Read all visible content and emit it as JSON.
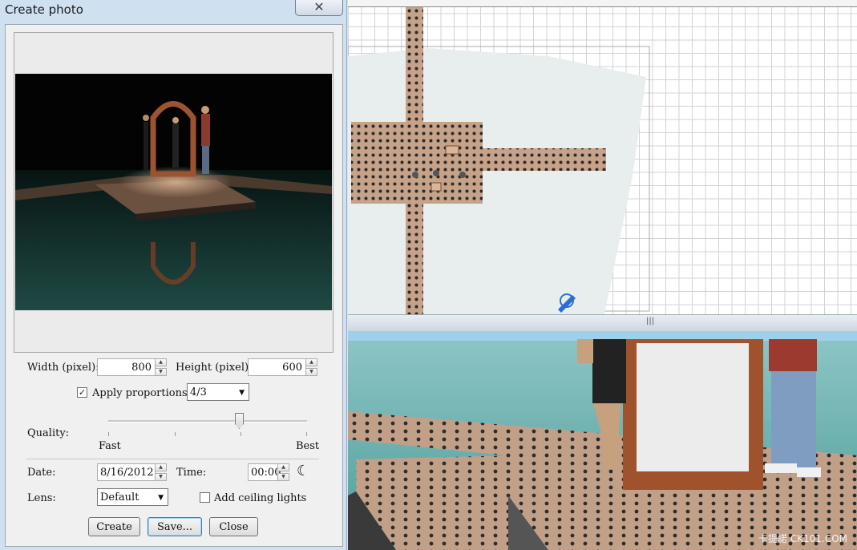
{
  "dialog": {
    "title": "Create photo",
    "close_icon": "close-icon",
    "width_label": "Width (pixel):",
    "width_value": "800",
    "height_label": "Height (pixel):",
    "height_value": "600",
    "apply_proportions_label": "Apply proportions:",
    "apply_proportions_checked": true,
    "proportion_value": "4/3",
    "quality_label": "Quality:",
    "quality_min": "Fast",
    "quality_max": "Best",
    "quality_level": 0.66,
    "date_label": "Date:",
    "date_value": "8/16/2012",
    "time_label": "Time:",
    "time_value": "00:00",
    "time_icon": "moon-icon",
    "lens_label": "Lens:",
    "lens_value": "Default",
    "ceiling_lights_label": "Add ceiling lights",
    "ceiling_lights_checked": false,
    "buttons": {
      "create": "Create",
      "save": "Save...",
      "close": "Close"
    }
  },
  "plan_view": {
    "splitter_grip": "|||"
  },
  "view3d": {
    "watermark": "卡提諾 CK101.COM"
  },
  "colors": {
    "dialog_bg": "#cfe0f1",
    "client_bg": "#f0f0f0",
    "floor_tile": "#b99279",
    "water": "#63b1ac",
    "door_frame": "#a0522d"
  }
}
